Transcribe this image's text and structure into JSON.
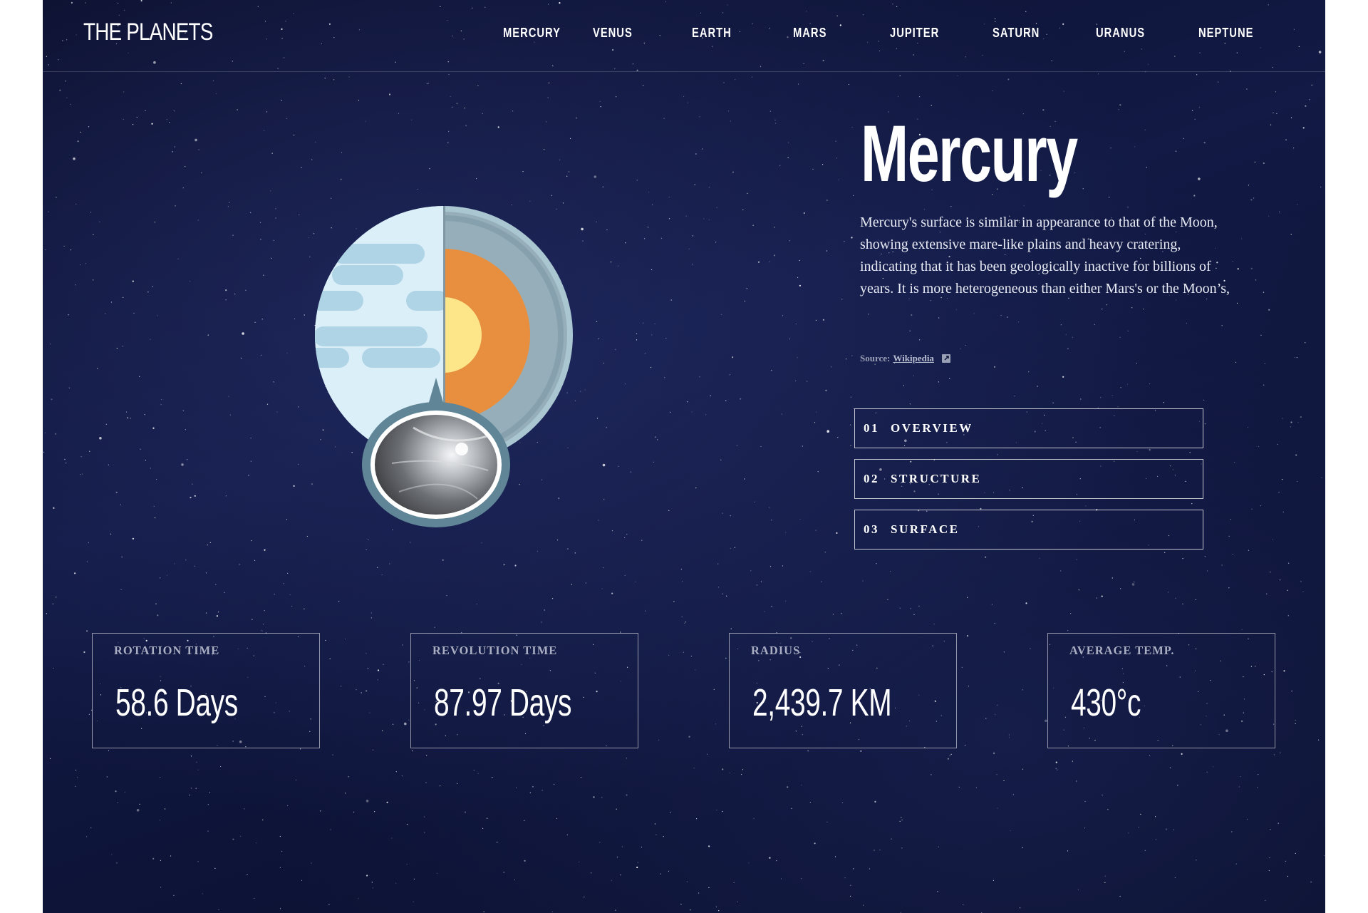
{
  "header": {
    "logo": "THE PLANETS",
    "nav": [
      "MERCURY",
      "VENUS",
      "EARTH",
      "MARS",
      "JUPITER",
      "SATURN",
      "URANUS",
      "NEPTUNE"
    ]
  },
  "planet": {
    "name": "Mercury",
    "description": "Mercury's surface is similar in appearance to that of the Moon, showing extensive mare-like plains and heavy cratering, indicating that it has been geologically inactive for billions of years. It is more heterogeneous than either Mars's or the Moon’s,",
    "source_prefix": "Source:",
    "source_link": "Wikipedia"
  },
  "tabs": [
    {
      "num": "01",
      "label": "OVERVIEW"
    },
    {
      "num": "02",
      "label": "STRUCTURE"
    },
    {
      "num": "03",
      "label": "SURFACE"
    }
  ],
  "stats": [
    {
      "label": "ROTATION TIME",
      "value": "58.6 Days"
    },
    {
      "label": "REVOLUTION TIME",
      "value": "87.97 Days"
    },
    {
      "label": "RADIUS",
      "value": "2,439.7 KM"
    },
    {
      "label": "AVERAGE TEMP.",
      "value": "430°c"
    }
  ],
  "icons": {
    "external_link": "external-link-icon"
  },
  "colors": {
    "background": "#0d1336",
    "planet_surface": "#dbeff8",
    "planet_bands": "#aed4e6",
    "crust": "#96aeba",
    "mantle": "#e88f3f",
    "core": "#fde58a",
    "lens_ring": "#5f8597"
  }
}
